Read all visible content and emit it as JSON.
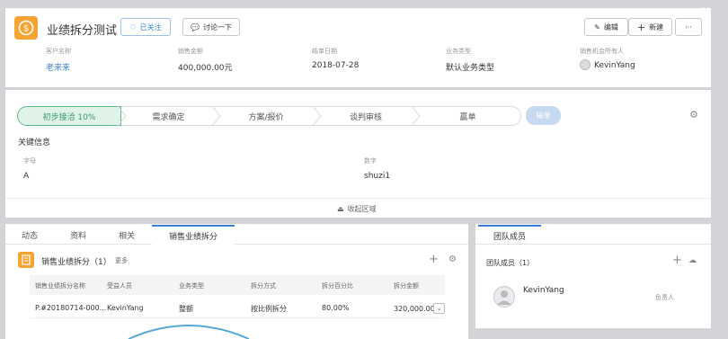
{
  "header": {
    "title": "业绩拆分测试",
    "follow_label": "已关注",
    "discuss_label": "讨论一下",
    "edit_label": "编辑",
    "new_label": "新建",
    "more_label": "···",
    "close_label": "×"
  },
  "summary": [
    {
      "label": "客户名称",
      "value": "老来来"
    },
    {
      "label": "销售金额",
      "value": "400,000.00元"
    },
    {
      "label": "结单日期",
      "value": "2018-07-28"
    },
    {
      "label": "业务类型",
      "value": "默认业务类型"
    },
    {
      "label": "销售机会所有人",
      "value": "KevinYang"
    }
  ],
  "stages": [
    "初步接洽 10%",
    "需求确定",
    "方案/报价",
    "谈判审核",
    "赢单"
  ],
  "lose_label": "输单",
  "key_info": {
    "title": "关键信息",
    "fields": [
      {
        "label": "字母",
        "value": "A"
      },
      {
        "label": "数字",
        "value": "shuzi1"
      }
    ],
    "collapse_label": "收起区域"
  },
  "tabs": [
    "动态",
    "资料",
    "相关",
    "销售业绩拆分"
  ],
  "split": {
    "title": "销售业绩拆分（1）",
    "more_label": "更多",
    "columns": [
      "销售业绩拆分名称",
      "受益人员",
      "业务类型",
      "拆分方式",
      "拆分百分比",
      "拆分金额"
    ],
    "rows": [
      [
        "P.#20180714-000...",
        "KevinYang",
        "整额",
        "按比例拆分",
        "80.00%",
        "320,000.00元"
      ]
    ]
  },
  "team": {
    "tab_label": "团队成员",
    "title": "团队成员（1）",
    "members": [
      {
        "name": "KevinYang",
        "role": "负责人"
      }
    ]
  },
  "colors": {
    "accent": "#3a7fd5",
    "stage_active": "#5cb88a",
    "logo": "#f5a332",
    "lose": "#c7d9ee"
  }
}
